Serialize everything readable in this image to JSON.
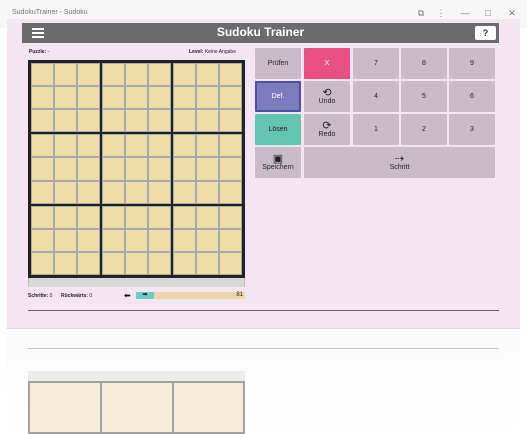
{
  "window": {
    "title": "SudokuTrainer - Sudoku"
  },
  "header": {
    "title": "Sudoku Trainer",
    "help_label": "?"
  },
  "info": {
    "puzzle_label": "Puzzle:",
    "puzzle_value": "-",
    "level_label": "Level:",
    "level_value": "Keine Angabe"
  },
  "stats": {
    "steps_label": "Schritte:",
    "steps_value": "0",
    "back_label": "Rückwärts:",
    "back_value": "0",
    "arrow_left": "⬅",
    "arrow_right": "➡",
    "count": "81"
  },
  "buttons": {
    "pruefen": "Prüfen",
    "x": "X",
    "def": "Def.",
    "undo": "Undo",
    "loesen": "Lösen",
    "redo": "Redo",
    "speichern": "Speichern",
    "schritt": "Schritt",
    "digits": [
      "7",
      "8",
      "9",
      "4",
      "5",
      "6",
      "1",
      "2",
      "3"
    ]
  },
  "colors": {
    "accent_pink": "#ea4f83",
    "accent_blue": "#7b7cbb",
    "accent_teal": "#64c4ad",
    "board": "#eedda6"
  },
  "icons": {
    "menu": "hamburger-menu-icon",
    "undo": "undo-icon",
    "redo": "redo-icon",
    "save": "save-icon",
    "step": "arrow-right-icon"
  }
}
